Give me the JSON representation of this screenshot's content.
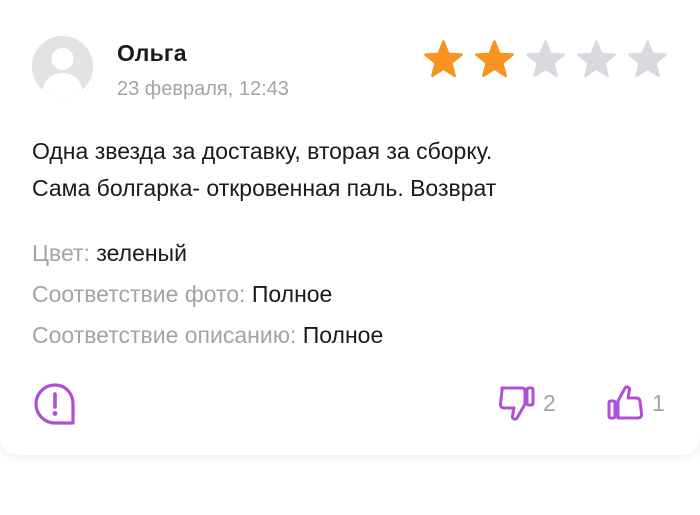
{
  "review": {
    "author": "Ольга",
    "date": "23 февраля, 12:43",
    "rating": 2,
    "max_rating": 5,
    "text_lines": [
      "Одна звезда за доставку, вторая за сборку.",
      "Сама болгарка- откровенная паль. Возврат"
    ],
    "attributes": [
      {
        "key": "Цвет:",
        "value": "зеленый"
      },
      {
        "key": "Соответствие фото:",
        "value": "Полное"
      },
      {
        "key": "Соответствие описанию:",
        "value": "Полное"
      }
    ]
  },
  "actions": {
    "complaint_icon": "exclamation-bubble-icon",
    "dislike_icon": "thumbs-down-icon",
    "dislike_count": "2",
    "like_icon": "thumbs-up-icon",
    "like_count": "1"
  },
  "colors": {
    "star_filled": "#f7931e",
    "star_empty": "#d9d9e0",
    "accent_purple": "#b04fd6",
    "muted_text": "#a3a3a8",
    "primary_text": "#1a1a1a",
    "avatar_bg": "#e3e3e6"
  }
}
